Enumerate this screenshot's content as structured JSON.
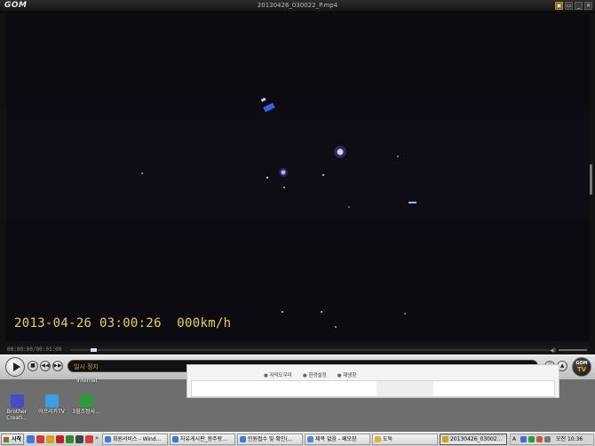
{
  "player": {
    "app_logo": "GOM",
    "title": "20130426_030022_P.mp4",
    "window_buttons": [
      "▣",
      "▭",
      "_",
      "✕"
    ],
    "osd_overlay": "2013-04-26 03:00:26  000km/h",
    "timecode": "00:00:00/00:01:00",
    "info_text": "일시 정지",
    "gomtv_label": "GOM",
    "gomtv_sub": "TV",
    "buttons": {
      "play": "▶",
      "stop": "■",
      "prev": "◀◀",
      "next": "▶▶",
      "playlist": "☰",
      "eject": "▲"
    }
  },
  "background_page": {
    "tabs": [
      "자막도우미",
      "환경설정",
      "재생창"
    ]
  },
  "desktop_icons": [
    {
      "label": "Internet",
      "color": "#2a6fc9"
    },
    {
      "label": "Brother\nCreati...",
      "color": "#4a4ac8"
    },
    {
      "label": "아프리카TV",
      "color": "#3aa0e0"
    },
    {
      "label": "3월조정사...",
      "color": "#2f9a3a"
    }
  ],
  "taskbar": {
    "start_label": "시작",
    "quick_launch_colors": [
      "#3a7bd5",
      "#d33a3a",
      "#d6a020",
      "#c02020",
      "#2f8a2f",
      "#444444",
      "#d04040"
    ],
    "chevron": "»",
    "tasks": [
      {
        "label": "회원서비스 - Wind...",
        "color": "#3a7bd5",
        "active": false
      },
      {
        "label": "자유게시판_왕주랑...",
        "color": "#3a7bd5",
        "active": false
      },
      {
        "label": "민원접수 및 확인(...",
        "color": "#3a7bd5",
        "active": false
      },
      {
        "label": "제목 없음 - 페모장",
        "color": "#4a8ad0",
        "active": false
      },
      {
        "label": "도둑",
        "color": "#e0b030",
        "active": false
      },
      {
        "label": "20130426_03002...",
        "color": "#d0a020",
        "active": true
      }
    ],
    "tray": {
      "lang_indicator": "A",
      "time_label": "오전 10:36",
      "icon_colors": [
        "#3a6fd5",
        "#2a9a3a",
        "#d05050",
        "#777777"
      ]
    }
  }
}
